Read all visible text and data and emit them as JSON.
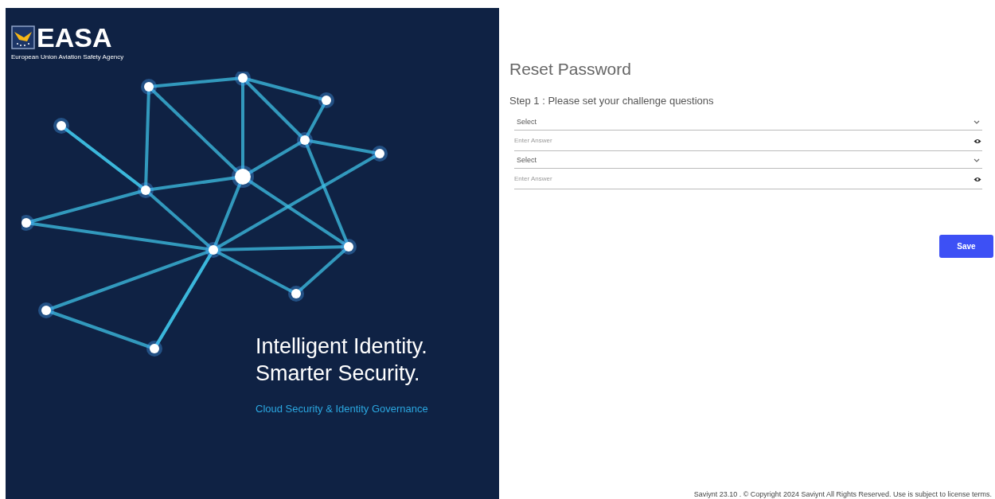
{
  "logo": {
    "acronym": "EASA",
    "subtitle": "European Union Aviation Safety Agency"
  },
  "hero": {
    "headline": [
      "Intelligent Identity.",
      "Smarter Security."
    ],
    "tagline": "Cloud Security & Identity Governance"
  },
  "form": {
    "title": "Reset Password",
    "step": "Step 1 : Please set your challenge questions",
    "fields": [
      {
        "kind": "select",
        "value": "Select"
      },
      {
        "kind": "answer",
        "placeholder": "Enter Answer"
      },
      {
        "kind": "select",
        "value": "Select"
      },
      {
        "kind": "answer",
        "placeholder": "Enter Answer"
      }
    ],
    "save": "Save"
  },
  "footer": "Saviynt 23.10 . © Copyright 2024 Saviynt All Rights Reserved. Use is subject to license terms."
}
